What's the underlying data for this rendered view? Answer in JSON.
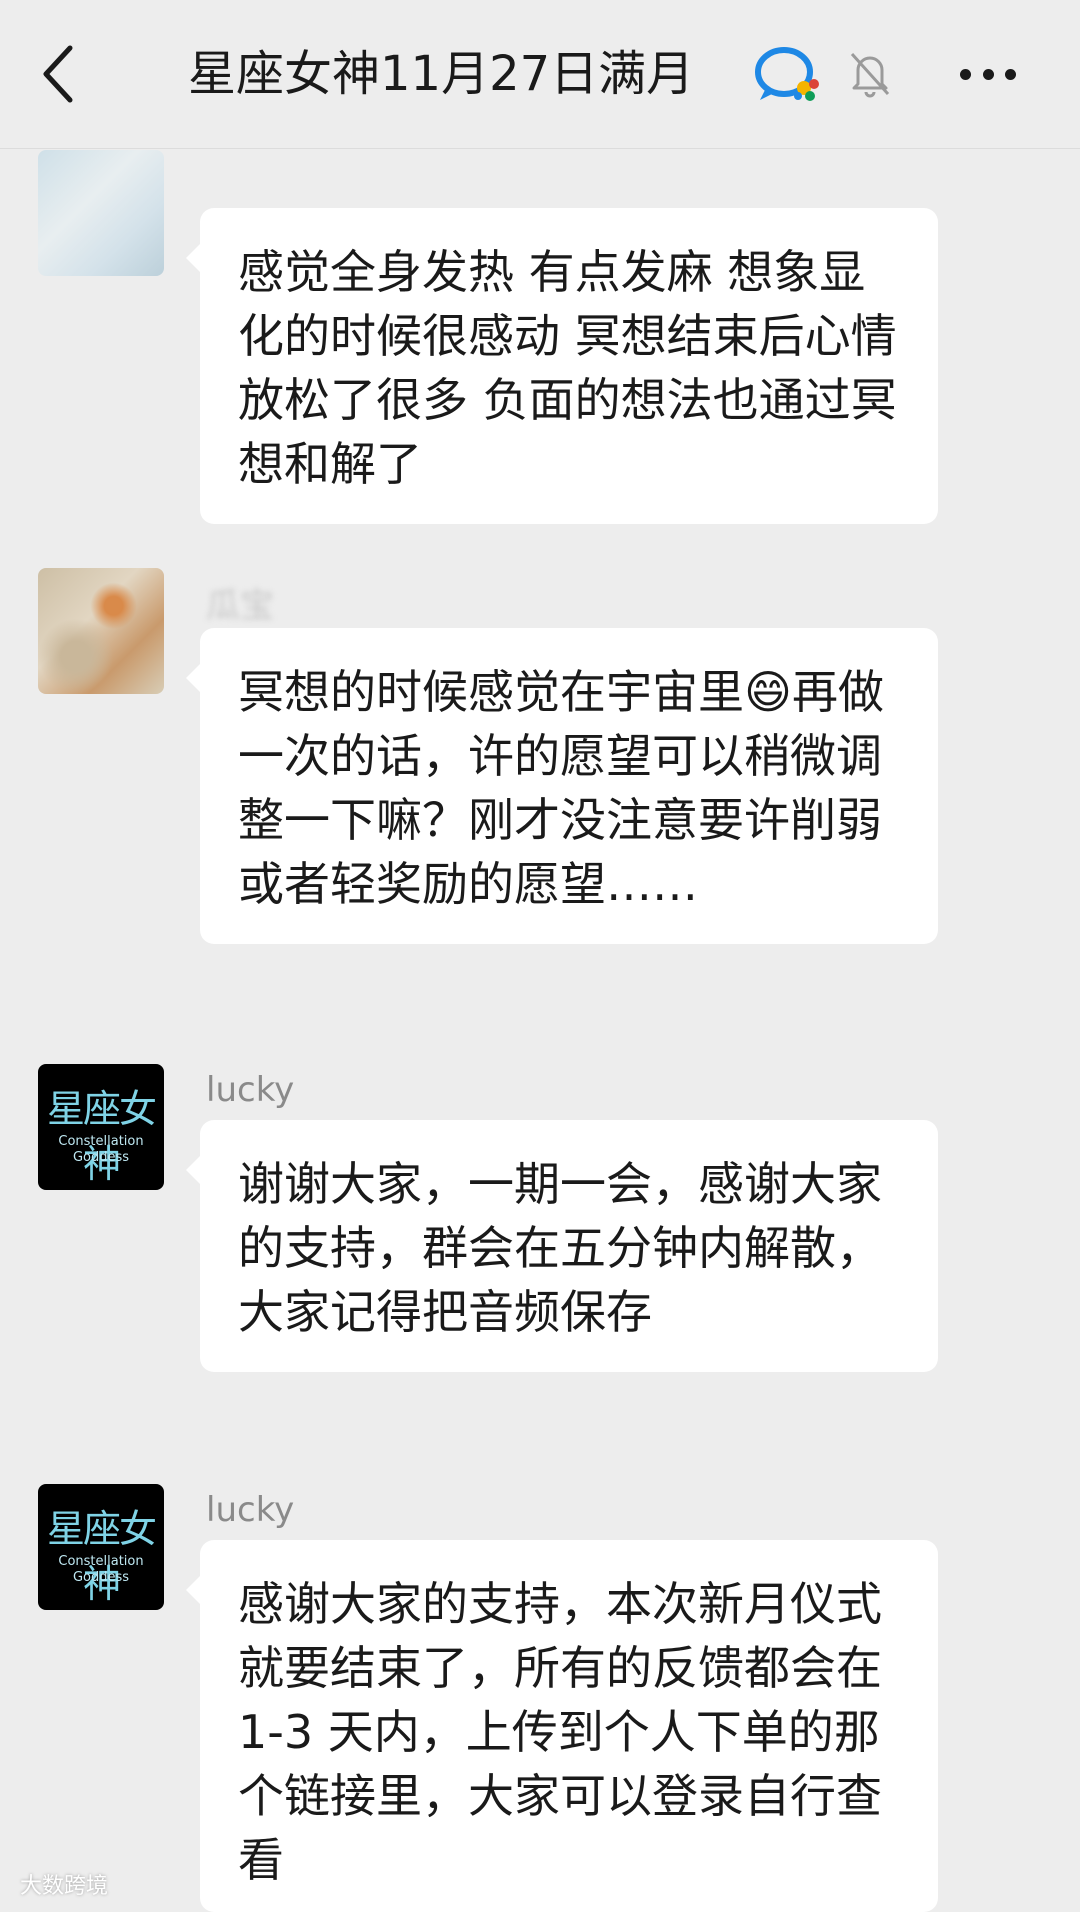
{
  "header": {
    "title": "星座女神11月27日满月",
    "back_icon": "chevron-left-icon",
    "chat_icon": "group-chat-icon",
    "mute_icon": "bell-muted-icon",
    "more_icon": "more-dots-icon"
  },
  "messages": [
    {
      "sender": "",
      "text": "感觉全身发热 有点发麻 想象显化的时候很感动 冥想结束后心情放松了很多 负面的想法也通过冥想和解了"
    },
    {
      "sender": "瓜宝",
      "text": "冥想的时候感觉在宇宙里😄再做一次的话，许的愿望可以稍微调整一下嘛？刚才没注意要许削弱或者轻奖励的愿望……"
    },
    {
      "sender": "lucky",
      "avatar_text": "星座女神",
      "avatar_sub1": "Constellation",
      "avatar_sub2": "Goddess",
      "text": "谢谢大家，一期一会，感谢大家的支持，群会在五分钟内解散，大家记得把音频保存"
    },
    {
      "sender": "lucky",
      "avatar_text": "星座女神",
      "avatar_sub1": "Constellation",
      "avatar_sub2": "Goddess",
      "text": "感谢大家的支持，本次新月仪式就要结束了，所有的反馈都会在 1-3 天内，上传到个人下单的那个链接里，大家可以登录自行查看"
    }
  ],
  "watermark": "大数跨境"
}
